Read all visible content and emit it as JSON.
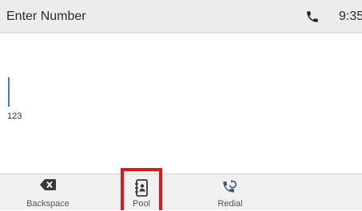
{
  "header": {
    "title": "Enter Number",
    "time": "9:35",
    "call_icon": "phone-handset-icon"
  },
  "dial": {
    "input_value": "123"
  },
  "softkeys": [
    {
      "label": "Backspace",
      "icon": "backspace-icon"
    },
    {
      "label": "Pool",
      "icon": "contacts-book-icon"
    },
    {
      "label": "Redial",
      "icon": "redial-icon"
    }
  ],
  "colors": {
    "header_bg": "#ececec",
    "softkey_bg": "#f1f1f1",
    "cursor": "#3d7fc6",
    "highlight_box": "#e5141a",
    "icon_dark": "#3a3a3a",
    "redial_accent": "#3a5a86"
  }
}
